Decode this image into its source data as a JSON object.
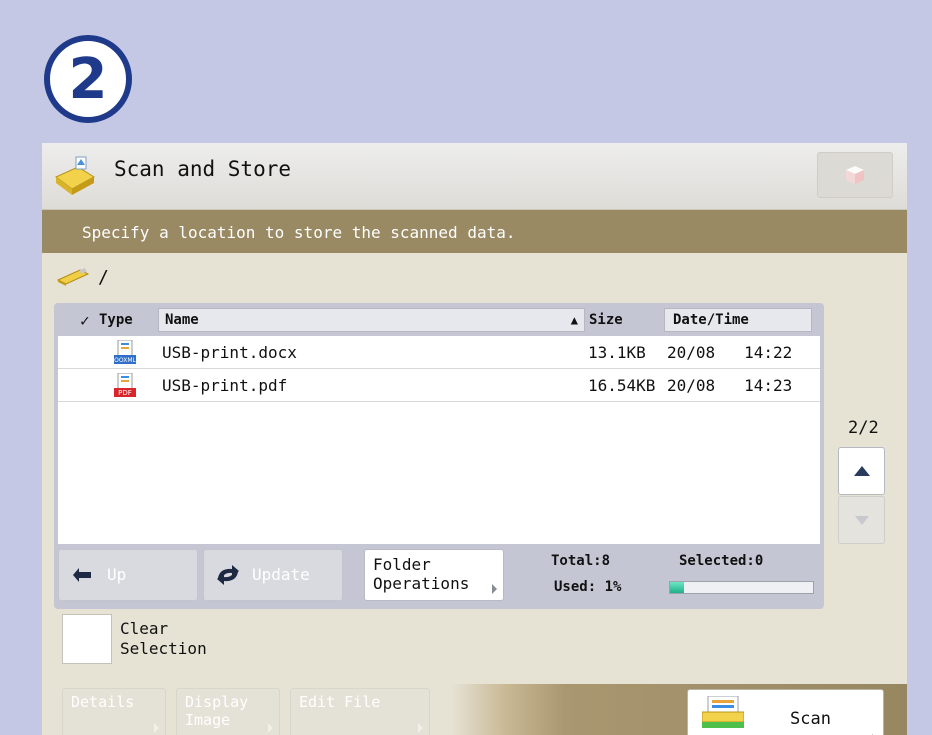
{
  "step_number": "2",
  "title": "Scan and Store",
  "instruction": "Specify a location to store the scanned data.",
  "path": "/",
  "list": {
    "headers": {
      "check": "✓",
      "type": "Type",
      "name": "Name",
      "size": "Size",
      "datetime": "Date/Time"
    },
    "sort_indicator": "▲",
    "files": [
      {
        "name": "USB-print.docx",
        "type_icon": "docx-file-icon",
        "size": "13.1KB",
        "date": "20/08",
        "time": "14:22"
      },
      {
        "name": "USB-print.pdf",
        "type_icon": "pdf-file-icon",
        "size": "16.54KB",
        "date": "20/08",
        "time": "14:23"
      }
    ]
  },
  "buttons": {
    "up": "Up",
    "update": "Update",
    "folder_ops_line1": "Folder",
    "folder_ops_line2": "Operations",
    "clear_line1": "Clear",
    "clear_line2": "Selection",
    "details": "Details",
    "display_line1": "Display",
    "display_line2": "Image",
    "edit_file": "Edit File",
    "scan": "Scan"
  },
  "stats": {
    "total": "Total:8",
    "selected": "Selected:0",
    "used": "Used: 1%",
    "used_fraction": 0.01
  },
  "pagination": "2/2",
  "colors": {
    "background": "#c5c8e4",
    "step_circle": "#1f3a8a",
    "instruction_bar": "#9a8a64",
    "usage_fill": "#1fb08a"
  }
}
